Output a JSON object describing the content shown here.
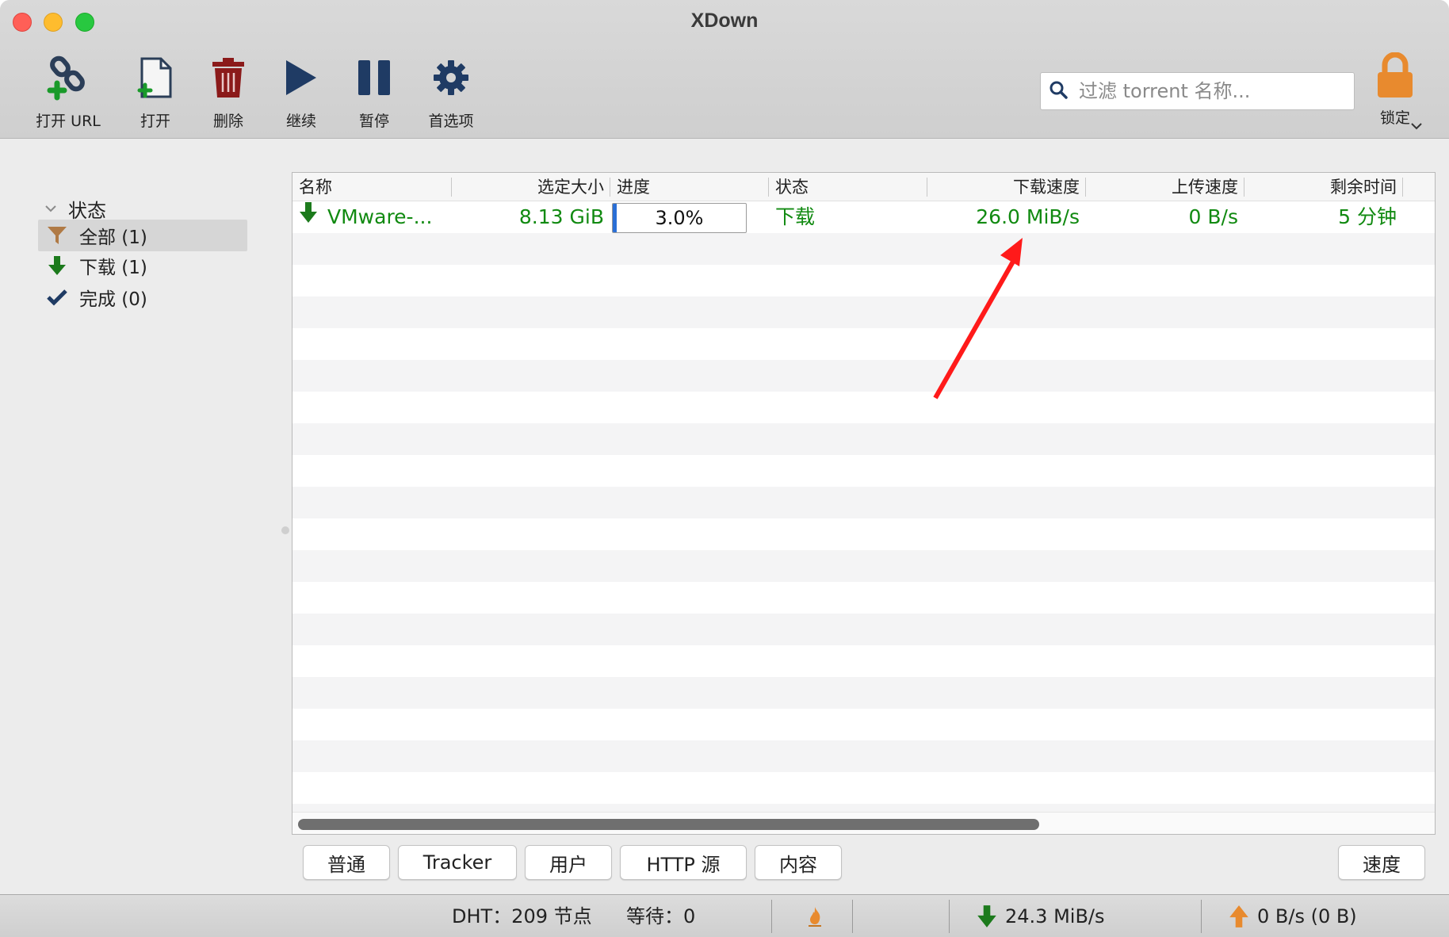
{
  "app": {
    "title": "XDown"
  },
  "toolbar": {
    "open_url": "打开 URL",
    "open": "打开",
    "delete": "删除",
    "resume": "继续",
    "pause": "暂停",
    "preferences": "首选项",
    "lock": "锁定"
  },
  "search": {
    "placeholder": "过滤 torrent 名称..."
  },
  "sidebar": {
    "section": "状态",
    "items": [
      {
        "label": "全部 (1)",
        "icon": "filter-icon",
        "selected": true
      },
      {
        "label": "下载 (1)",
        "icon": "download-arrow-icon",
        "selected": false
      },
      {
        "label": "完成 (0)",
        "icon": "checkmark-icon",
        "selected": false
      }
    ]
  },
  "table": {
    "columns": [
      "名称",
      "选定大小",
      "进度",
      "状态",
      "下载速度",
      "上传速度",
      "剩余时间"
    ],
    "rows": [
      {
        "name": "VMware-...",
        "size": "8.13 GiB",
        "progress_text": "3.0%",
        "progress": 0.03,
        "status": "下载",
        "download_speed": "26.0 MiB/s",
        "upload_speed": "0 B/s",
        "remaining": "5 分钟"
      }
    ]
  },
  "detail_tabs": {
    "general": "普通",
    "tracker": "Tracker",
    "peers": "用户",
    "http_sources": "HTTP 源",
    "content": "内容",
    "speed": "速度"
  },
  "statusbar": {
    "dht": "DHT：209 节点",
    "waiting": "等待：0",
    "download_rate": "24.3 MiB/s",
    "upload_rate": "0 B/s (0 B)"
  },
  "colors": {
    "row_text": "#118a11",
    "accent_blue": "#1f3b64",
    "delete_red": "#8b1a1a",
    "lock_orange": "#e88a2e",
    "annotation_arrow": "#ff1a1a"
  }
}
